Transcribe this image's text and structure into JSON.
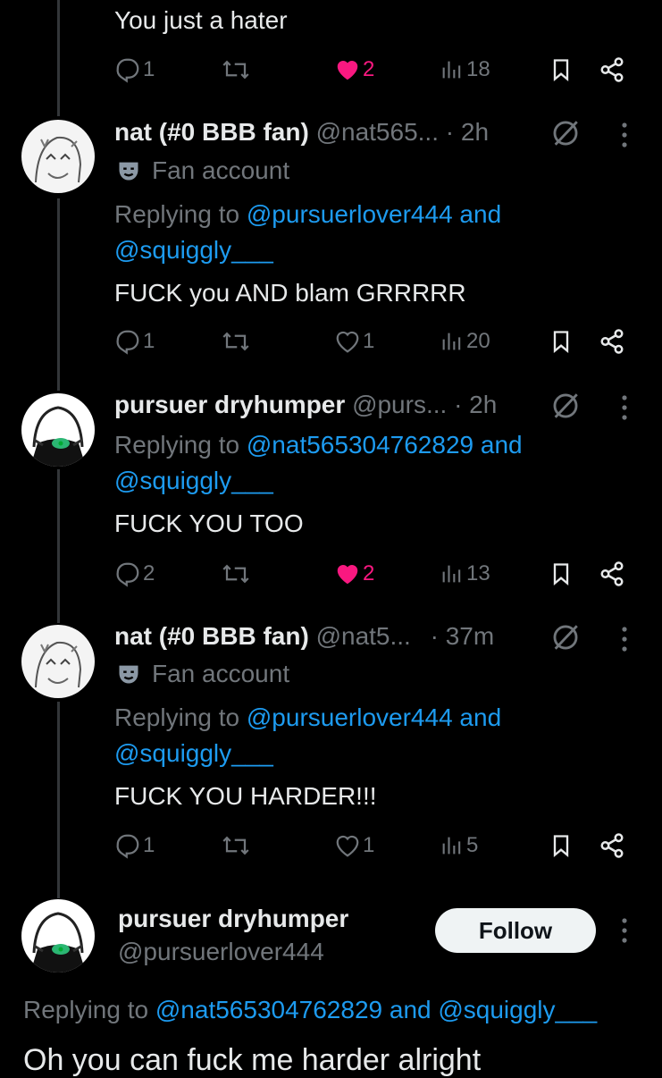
{
  "colors": {
    "background": "#000000",
    "text": "#e7e9ea",
    "muted": "#71767b",
    "link": "#1d9bf0",
    "like": "#f91880"
  },
  "top_tweet": {
    "text": "You just a hater",
    "actions": {
      "replies": "1",
      "likes": "2",
      "views": "18",
      "liked": true
    }
  },
  "tweets": [
    {
      "name": "nat (#0 BBB fan)",
      "handle": "@nat565...",
      "time": "· 2h",
      "badge": "Fan account",
      "replying_prefix": "Replying to",
      "replying_line1": "@pursuerlover444 and",
      "replying_line2": "@squiggly___",
      "text": "FUCK you AND blam GRRRRR",
      "actions": {
        "replies": "1",
        "likes": "1",
        "views": "20",
        "liked": false
      }
    },
    {
      "name": "pursuer dryhumper",
      "handle": "@purs...",
      "time": "· 2h",
      "replying_prefix": "Replying to",
      "replying_line1": "@nat565304762829 and",
      "replying_line2": "@squiggly___",
      "text": "FUCK YOU TOO",
      "actions": {
        "replies": "2",
        "likes": "2",
        "views": "13",
        "liked": true
      }
    },
    {
      "name": "nat (#0 BBB fan)",
      "handle": "@nat5...",
      "time": "· 37m",
      "badge": "Fan account",
      "replying_prefix": "Replying to",
      "replying_line1": "@pursuerlover444 and",
      "replying_line2": "@squiggly___",
      "text": "FUCK YOU HARDER!!!",
      "actions": {
        "replies": "1",
        "likes": "1",
        "views": "5",
        "liked": false
      }
    }
  ],
  "focused": {
    "name": "pursuer dryhumper",
    "handle": "@pursuerlover444",
    "follow_label": "Follow",
    "replying_prefix": "Replying to",
    "replying_text": "@nat565304762829 and @squiggly___",
    "text": "Oh you can fuck me harder alright"
  },
  "icons": [
    "reply-icon",
    "retweet-icon",
    "like-icon",
    "views-icon",
    "bookmark-icon",
    "share-icon",
    "more-icon",
    "grok-icon",
    "fan-mask-icon"
  ]
}
